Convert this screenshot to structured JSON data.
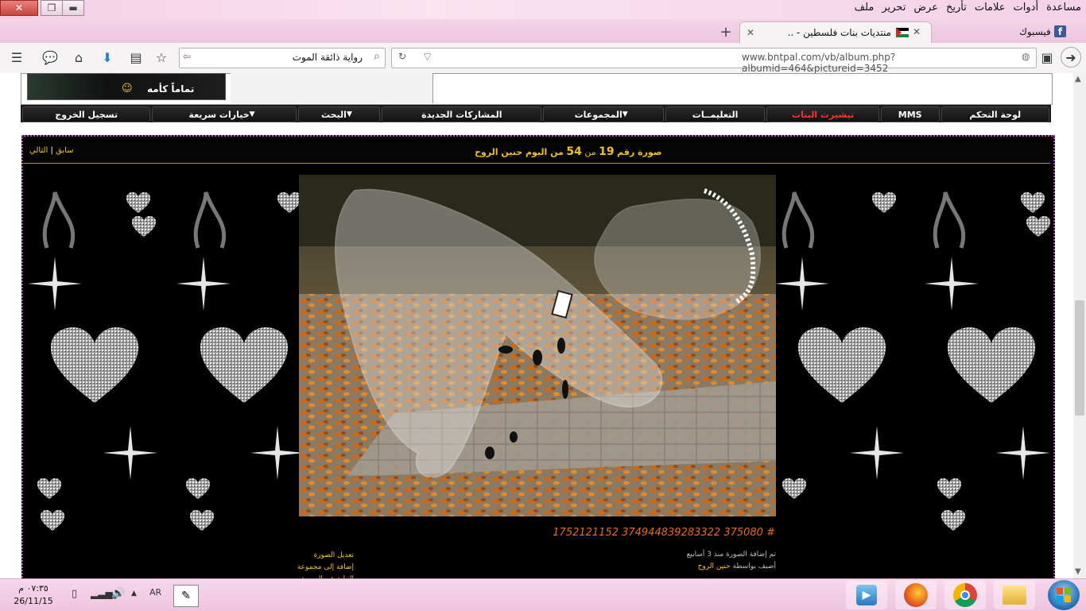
{
  "window": {
    "menu": [
      "ملف",
      "تحرير",
      "عرض",
      "تأريخ",
      "علامات",
      "أدوات",
      "مساعدة"
    ],
    "controls": {
      "close": "✕",
      "restore": "❐",
      "minimize": "▬"
    }
  },
  "tabs": [
    {
      "title": "فيسبوك",
      "icon": "facebook-icon"
    },
    {
      "title": "منتديات بنات فلسطين - ...",
      "icon": "palestine-flag-icon",
      "active": true
    }
  ],
  "navbar": {
    "url": "www.bntpal.com/vb/album.php?albumid=464&pictureid=3452",
    "search_value": "رواية ذائقة الموت"
  },
  "forum_nav": [
    "لوحة التحكم",
    "MMS",
    "تيشيرت البنات",
    "التعليمــات",
    "المجموعات",
    "المشاركات الجديدة",
    "البحث",
    "خيارات سريعة",
    "تسجيل الخروج"
  ],
  "forum_nav_highlight_color": "#ff3030",
  "banner_text": "تماماً كأمه",
  "album": {
    "prefix": "صورة رقم",
    "num": "19",
    "of": "من",
    "total": "54",
    "suffix": "من البوم حنين الروح",
    "prev": "سابق",
    "sep": "|",
    "next": "التالي",
    "caption_id": "1752121152 374944839283322 375080",
    "caption_mark": "#",
    "added_text": "تم إضافة الصورة منذ 3 أسابيع",
    "added_by_prefix": "أضيف بواسطة",
    "added_by_user": "حنين الروح",
    "links": [
      "تعديل الصورة",
      "إضافة إلى مجموعة",
      "التبليغ عن الصورة"
    ],
    "accent_color": "#f0c020",
    "caption_color": "#e86a1e"
  },
  "taskbar": {
    "time": "٠٧:٣٥ م",
    "date": "26/11/15",
    "lang": "AR",
    "apps": [
      "media-player-icon",
      "firefox-icon",
      "chrome-icon",
      "file-explorer-icon"
    ]
  }
}
